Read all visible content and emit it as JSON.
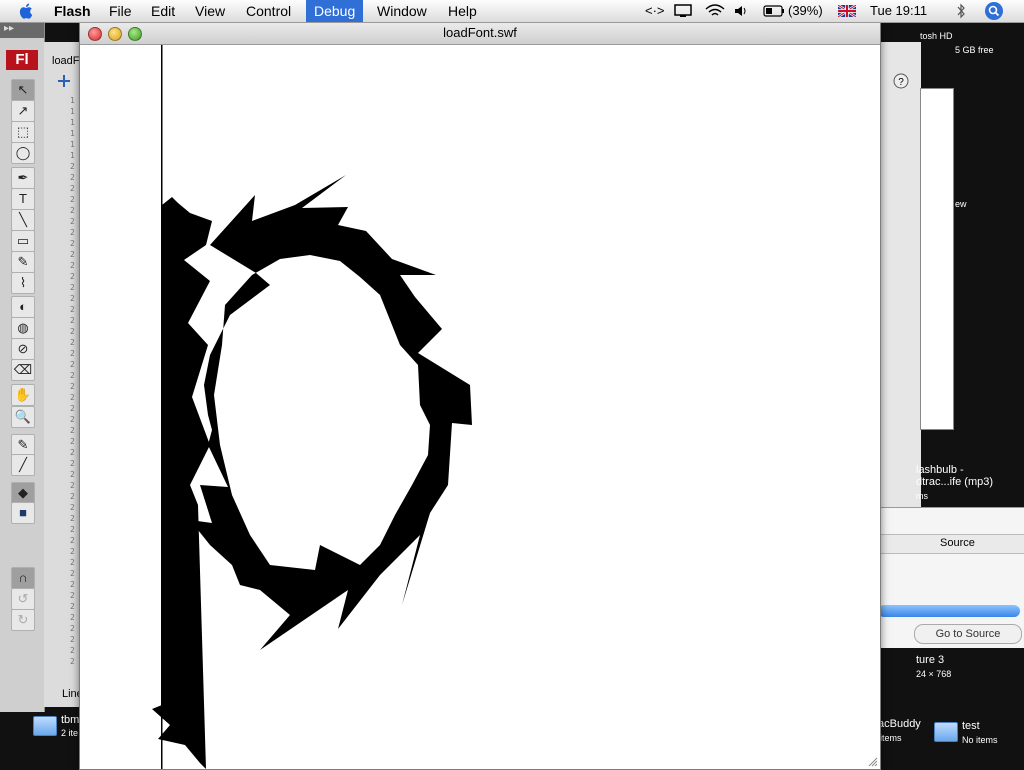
{
  "menubar": {
    "app": "Flash",
    "items": [
      "File",
      "Edit",
      "View",
      "Control",
      "Debug",
      "Window",
      "Help"
    ],
    "active": "Debug",
    "battery": "(39%)",
    "clock": "Tue 19:11"
  },
  "tools": {
    "logo": "Fl",
    "items": [
      "↖",
      "↗",
      "⬚",
      "◯",
      "✒",
      "T",
      "╲",
      "▭",
      "✎",
      "⌇",
      "◐",
      "◍",
      "⊘",
      "⌫",
      "✋",
      "🔍",
      "✎",
      "╱",
      "◆",
      "■",
      "∩",
      "↺",
      "↻"
    ]
  },
  "ide": {
    "tab": "loadF",
    "gutter": "1\n1\n1\n1\n1\n1\n2\n2\n2\n2\n2\n2\n2\n2\n2\n2\n2\n2\n2\n2\n2\n2\n2\n2\n2\n2\n2\n2\n2\n2\n2\n2\n2\n2\n2\n2\n2\n2\n2\n2\n2\n2\n2\n2\n2\n2\n2\n2\n2\n2\n2\n2",
    "bottom_label": "Line"
  },
  "swf_window": {
    "title": "loadFont.swf"
  },
  "output_panel": {
    "source_header": "Source",
    "goto_button": "Go to Source"
  },
  "desktop": {
    "hd_label": "tosh HD",
    "free": "5 GB free",
    "new_label": "ew",
    "flashbulb1": "lashbulb -",
    "flashbulb2": "dtrac...ife (mp3)",
    "items_label": "ms",
    "picture": "ture 3",
    "picture_size": "24 × 768",
    "left_folder": "tbm",
    "left_folder_sub": "2 ite",
    "macbuddy": "acBuddy",
    "macbuddy_sub": "items",
    "test": "test",
    "test_sub": "No items"
  }
}
